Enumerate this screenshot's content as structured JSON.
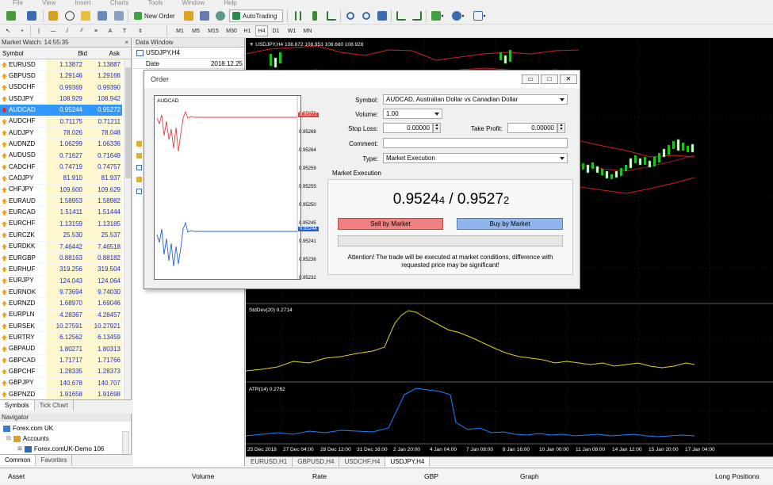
{
  "menu": [
    "File",
    "View",
    "Insert",
    "Charts",
    "Tools",
    "Window",
    "Help"
  ],
  "toolbar": {
    "new_order": "New Order",
    "autotrading": "AutoTrading"
  },
  "timeframes": [
    "M1",
    "M5",
    "M15",
    "M30",
    "H1",
    "H4",
    "D1",
    "W1",
    "MN"
  ],
  "market_watch": {
    "title": "Market Watch: 14:55:35",
    "headers": [
      "Symbol",
      "Bid",
      "Ask"
    ],
    "rows": [
      {
        "symbol": "EURUSD",
        "bid": "1.13872",
        "ask": "1.13887",
        "dir": "up"
      },
      {
        "symbol": "GBPUSD",
        "bid": "1.29146",
        "ask": "1.29166",
        "dir": "up"
      },
      {
        "symbol": "USDCHF",
        "bid": "0.99369",
        "ask": "0.99390",
        "dir": "up"
      },
      {
        "symbol": "USDJPY",
        "bid": "108.929",
        "ask": "108.942",
        "dir": "up"
      },
      {
        "symbol": "AUDCAD",
        "bid": "0.95244",
        "ask": "0.95272",
        "dir": "down",
        "selected": true
      },
      {
        "symbol": "AUDCHF",
        "bid": "0.71175",
        "ask": "0.71211",
        "dir": "up"
      },
      {
        "symbol": "AUDJPY",
        "bid": "78.026",
        "ask": "78.048",
        "dir": "up"
      },
      {
        "symbol": "AUDNZD",
        "bid": "1.06299",
        "ask": "1.06336",
        "dir": "up"
      },
      {
        "symbol": "AUDUSD",
        "bid": "0.71627",
        "ask": "0.71649",
        "dir": "up"
      },
      {
        "symbol": "CADCHF",
        "bid": "0.74719",
        "ask": "0.74757",
        "dir": "up"
      },
      {
        "symbol": "CADJPY",
        "bid": "81.910",
        "ask": "81.937",
        "dir": "up"
      },
      {
        "symbol": "CHFJPY",
        "bid": "109.600",
        "ask": "109.629",
        "dir": "up"
      },
      {
        "symbol": "EURAUD",
        "bid": "1.58953",
        "ask": "1.58982",
        "dir": "up"
      },
      {
        "symbol": "EURCAD",
        "bid": "1.51411",
        "ask": "1.51444",
        "dir": "up"
      },
      {
        "symbol": "EURCHF",
        "bid": "1.13159",
        "ask": "1.13185",
        "dir": "up"
      },
      {
        "symbol": "EURCZK",
        "bid": "25.530",
        "ask": "25.537",
        "dir": "up"
      },
      {
        "symbol": "EURDKK",
        "bid": "7.46442",
        "ask": "7.46518",
        "dir": "up"
      },
      {
        "symbol": "EURGBP",
        "bid": "0.88163",
        "ask": "0.88182",
        "dir": "up"
      },
      {
        "symbol": "EURHUF",
        "bid": "319.256",
        "ask": "319.504",
        "dir": "up"
      },
      {
        "symbol": "EURJPY",
        "bid": "124.043",
        "ask": "124.064",
        "dir": "up"
      },
      {
        "symbol": "EURNOK",
        "bid": "9.73694",
        "ask": "9.74030",
        "dir": "up"
      },
      {
        "symbol": "EURNZD",
        "bid": "1.68970",
        "ask": "1.69046",
        "dir": "up"
      },
      {
        "symbol": "EURPLN",
        "bid": "4.28367",
        "ask": "4.28457",
        "dir": "up"
      },
      {
        "symbol": "EURSEK",
        "bid": "10.27591",
        "ask": "10.27921",
        "dir": "up"
      },
      {
        "symbol": "EURTRY",
        "bid": "6.12562",
        "ask": "6.13459",
        "dir": "up"
      },
      {
        "symbol": "GBPAUD",
        "bid": "1.80271",
        "ask": "1.80313",
        "dir": "up"
      },
      {
        "symbol": "GBPCAD",
        "bid": "1.71717",
        "ask": "1.71766",
        "dir": "up"
      },
      {
        "symbol": "GBPCHF",
        "bid": "1.28335",
        "ask": "1.28373",
        "dir": "up"
      },
      {
        "symbol": "GBPJPY",
        "bid": "140.678",
        "ask": "140.707",
        "dir": "up"
      },
      {
        "symbol": "GBPNZD",
        "bid": "1.91658",
        "ask": "1.91698",
        "dir": "up"
      }
    ],
    "tabs": [
      "Symbols",
      "Tick Chart"
    ]
  },
  "navigator": {
    "title": "Navigator",
    "root": "Forex.com UK",
    "accounts": "Accounts",
    "account": "Forex.comUK-Demo 106",
    "tabs": [
      "Common",
      "Favorites"
    ]
  },
  "data_window": {
    "title": "Data Window",
    "symbol": "USDJPY,H4",
    "date_label": "Date",
    "date_value": "2018.12.25"
  },
  "chart": {
    "header": "USDJPY,H4  108.872 108.953 108.680 108.928",
    "stddev_label": "StdDev(20) 0.2714",
    "atr_label": "ATR(14) 0.2762",
    "x_labels": [
      "25 Dec 2018",
      "27 Dec 04:00",
      "28 Dec 12:00",
      "31 Dec 16:00",
      "2 Jan 20:00",
      "4 Jan 04:00",
      "7 Jan 08:00",
      "8 Jan 16:00",
      "10 Jan 00:00",
      "11 Jan 08:00",
      "14 Jan 12:00",
      "15 Jan 20:00",
      "17 Jan 04:00"
    ],
    "tabs": [
      "EURUSD,H1",
      "GBPUSD,H4",
      "USDCHF,H4",
      "USDJPY,H4"
    ],
    "active_tab": "USDJPY,H4"
  },
  "order_dialog": {
    "title": "Order",
    "mini_chart_symbol": "AUDCAD",
    "mini_chart_ticks": [
      "0.95272",
      "0.95268",
      "0.95264",
      "0.95259",
      "0.95255",
      "0.95250",
      "0.95245",
      "0.95241",
      "0.95236",
      "0.95232"
    ],
    "ask_marker": "0.95272",
    "bid_marker": "0.95244",
    "symbol_label": "Symbol:",
    "symbol_value": "AUDCAD, Australian Dollar vs Canadian Dollar",
    "volume_label": "Volume:",
    "volume_value": "1.00",
    "stoploss_label": "Stop Loss:",
    "stoploss_value": "0.00000",
    "takeprofit_label": "Take Profit:",
    "takeprofit_value": "0.00000",
    "comment_label": "Comment:",
    "comment_value": "",
    "type_label": "Type:",
    "type_value": "Market Execution",
    "section_title": "Market Execution",
    "bid_quote_main": "0.9524",
    "bid_quote_small": "4",
    "quote_separator": " / ",
    "ask_quote_main": "0.9527",
    "ask_quote_small": "2",
    "sell_button": "Sell by Market",
    "buy_button": "Buy by Market",
    "attention": "Attention! The trade will be executed at market conditions, difference with requested price may be significant!"
  },
  "terminal": {
    "columns": [
      "Asset",
      "Volume",
      "Rate",
      "GBP",
      "Graph",
      "Long Positions"
    ]
  },
  "colors": {
    "sell": "#f08080",
    "buy": "#90b4ec",
    "ask_line": "#e04040",
    "bid_line": "#2060d0"
  }
}
